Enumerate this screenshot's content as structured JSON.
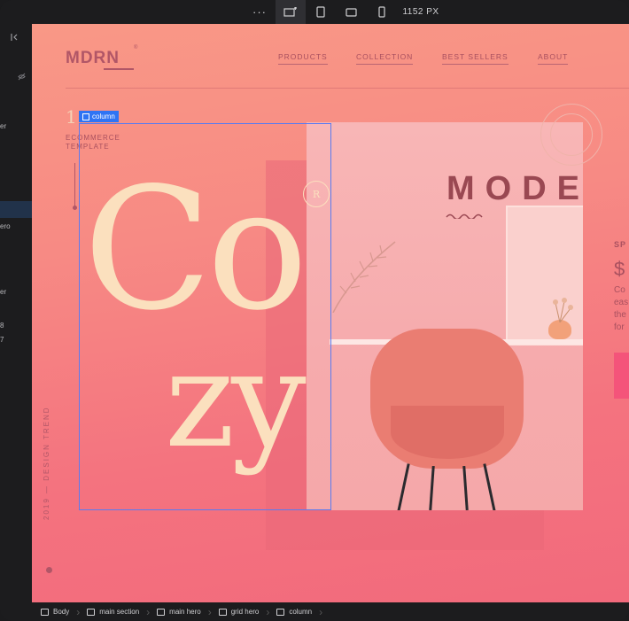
{
  "toolbar": {
    "more_label": "···",
    "width_label": "1152 PX"
  },
  "left_panel": {
    "items": [
      "er",
      "ero",
      "er",
      "8",
      "7"
    ]
  },
  "site": {
    "brand": "MDRN",
    "brand_mark": "®",
    "nav": [
      "PRODUCTS",
      "COLLECTION",
      "BEST SELLERS",
      "ABOUT"
    ],
    "number": "1",
    "eyebrow": [
      "ECOMMERCE",
      "TEMPLATE"
    ],
    "hero_word_1": "Co",
    "hero_word_2": "zy",
    "badge": "R",
    "section_title": "MODE",
    "right_label": "SP",
    "right_price": "$",
    "right_lines": [
      "Co",
      "eas",
      "the",
      "for"
    ],
    "side_text": "2019 — DESIGN TREND"
  },
  "selection": {
    "label": "column",
    "color": "#2f74f4"
  },
  "breadcrumb": [
    "Body",
    "main section",
    "main hero",
    "grid hero",
    "column"
  ],
  "colors": {
    "canvas_top": "#f99886",
    "canvas_bottom": "#f26a7c",
    "brand": "#b15667",
    "hero_text": "#fbe0be"
  }
}
